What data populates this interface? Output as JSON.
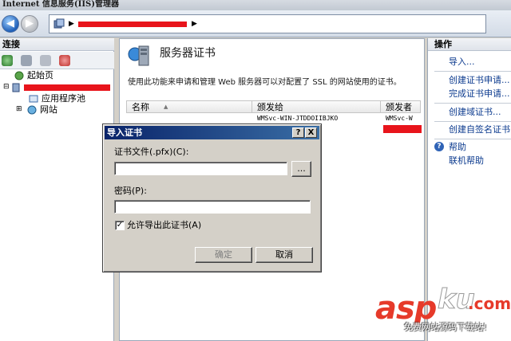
{
  "window": {
    "title": "Internet 信息服务(IIS)管理器"
  },
  "nav": {
    "back_icon": "back-arrow-icon",
    "forward_icon": "forward-arrow-icon",
    "address_sep": "▶",
    "address_sep2": "▶"
  },
  "connections": {
    "header": "连接",
    "tree": [
      {
        "label": "起始页",
        "icon": "start-page-icon"
      },
      {
        "label": "",
        "icon": "server-icon",
        "redacted": true
      },
      {
        "label": "应用程序池",
        "icon": "app-pool-icon"
      },
      {
        "label": "网站",
        "icon": "sites-icon"
      }
    ]
  },
  "center": {
    "title": "服务器证书",
    "description": "使用此功能来申请和管理 Web 服务器可以对配置了 SSL 的网站使用的证书。",
    "columns": [
      "名称",
      "颁发给",
      "颁发者"
    ],
    "rows": [
      {
        "name": "",
        "issued_to": "WMSvc-WIN-JTDDOIIBJKO",
        "issued_by": "WMSvc-W"
      }
    ]
  },
  "actions": {
    "header": "操作",
    "items": [
      "导入...",
      "创建证书申请...",
      "完成证书申请...",
      "创建域证书...",
      "创建自签名证书..."
    ],
    "help": "帮助",
    "online_help": "联机帮助"
  },
  "dialog": {
    "title": "导入证书",
    "help_btn": "?",
    "close_btn": "X",
    "file_label": "证书文件(.pfx)(C):",
    "file_value": "",
    "browse_btn": "...",
    "password_label": "密码(P):",
    "password_value": "",
    "checkbox_checked": true,
    "checkbox_mark": "✓",
    "checkbox_label": "允许导出此证书(A)",
    "ok_btn": "确定",
    "cancel_btn": "取消"
  },
  "watermark": {
    "asp": "asp",
    "ku": "ku",
    "com": ".com",
    "sub": "免费网站源码下载站!"
  },
  "colors": {
    "accent": "#0a246a",
    "link": "#0b3a8e",
    "redaction": "#e8141b",
    "watermark": "#e63a2a"
  }
}
